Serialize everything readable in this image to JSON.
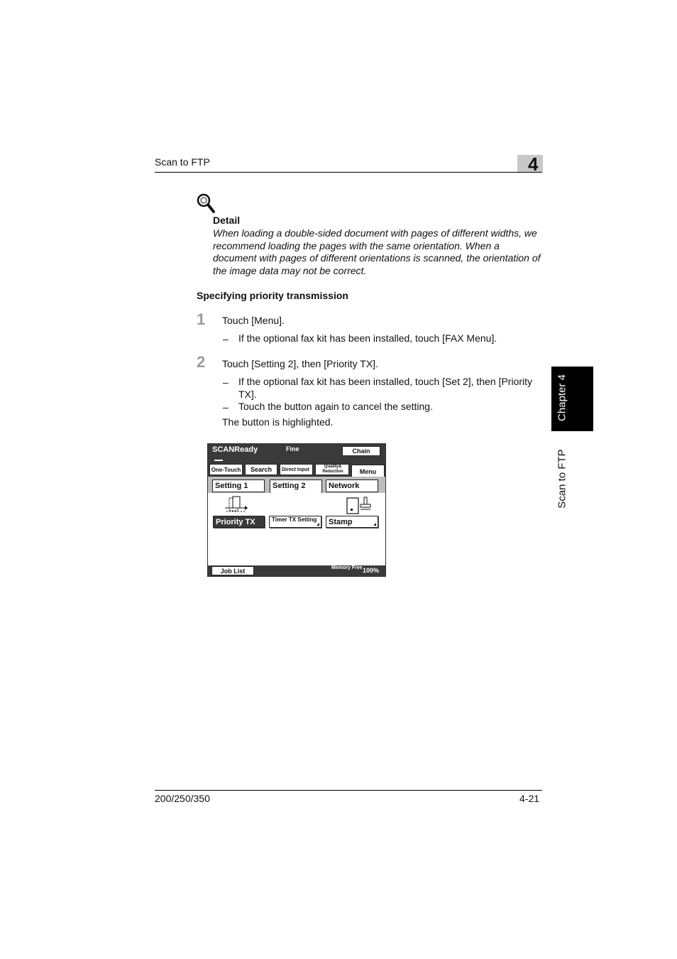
{
  "header": {
    "title": "Scan to FTP",
    "chapter_number": "4"
  },
  "side_tab": {
    "chapter": "Chapter 4",
    "section": "Scan to FTP"
  },
  "detail": {
    "label": "Detail",
    "text": "When loading a double-sided document with pages of different widths, we recommend loading the pages with the same orientation. When a document with pages of different orientations is scanned, the orientation of the image data may not be correct.",
    "icon": "magnifier-icon"
  },
  "subheading": "Specifying priority transmission",
  "steps": [
    {
      "number": "1",
      "text": "Touch [Menu].",
      "subitems": [
        "If the optional fax kit has been installed, touch [FAX Menu]."
      ]
    },
    {
      "number": "2",
      "text": "Touch [Setting 2], then [Priority TX].",
      "subitems": [
        "If the optional fax kit has been installed, touch [Set 2], then [Priority TX].",
        "Touch the button again to cancel the setting."
      ],
      "note": "The button is highlighted."
    }
  ],
  "dash": "–",
  "panel": {
    "status": "SCANReady",
    "resolution": "Fine",
    "chain": "Chain",
    "tabs": {
      "one_touch": "One-Touch",
      "search": "Search",
      "direct_input": "Direct Input",
      "quality_reduction": "Quality& Reduction",
      "menu": "Menu"
    },
    "setting_tabs": [
      "Setting 1",
      "Setting 2",
      "Network"
    ],
    "functions": {
      "priority_tx": "Priority TX",
      "timer_tx": "Timer TX Setting",
      "stamp": "Stamp"
    },
    "job_list": "Job List",
    "memory_label": "Memory Free",
    "memory_value": "100%"
  },
  "footer": {
    "model": "200/250/350",
    "page": "4-21"
  }
}
